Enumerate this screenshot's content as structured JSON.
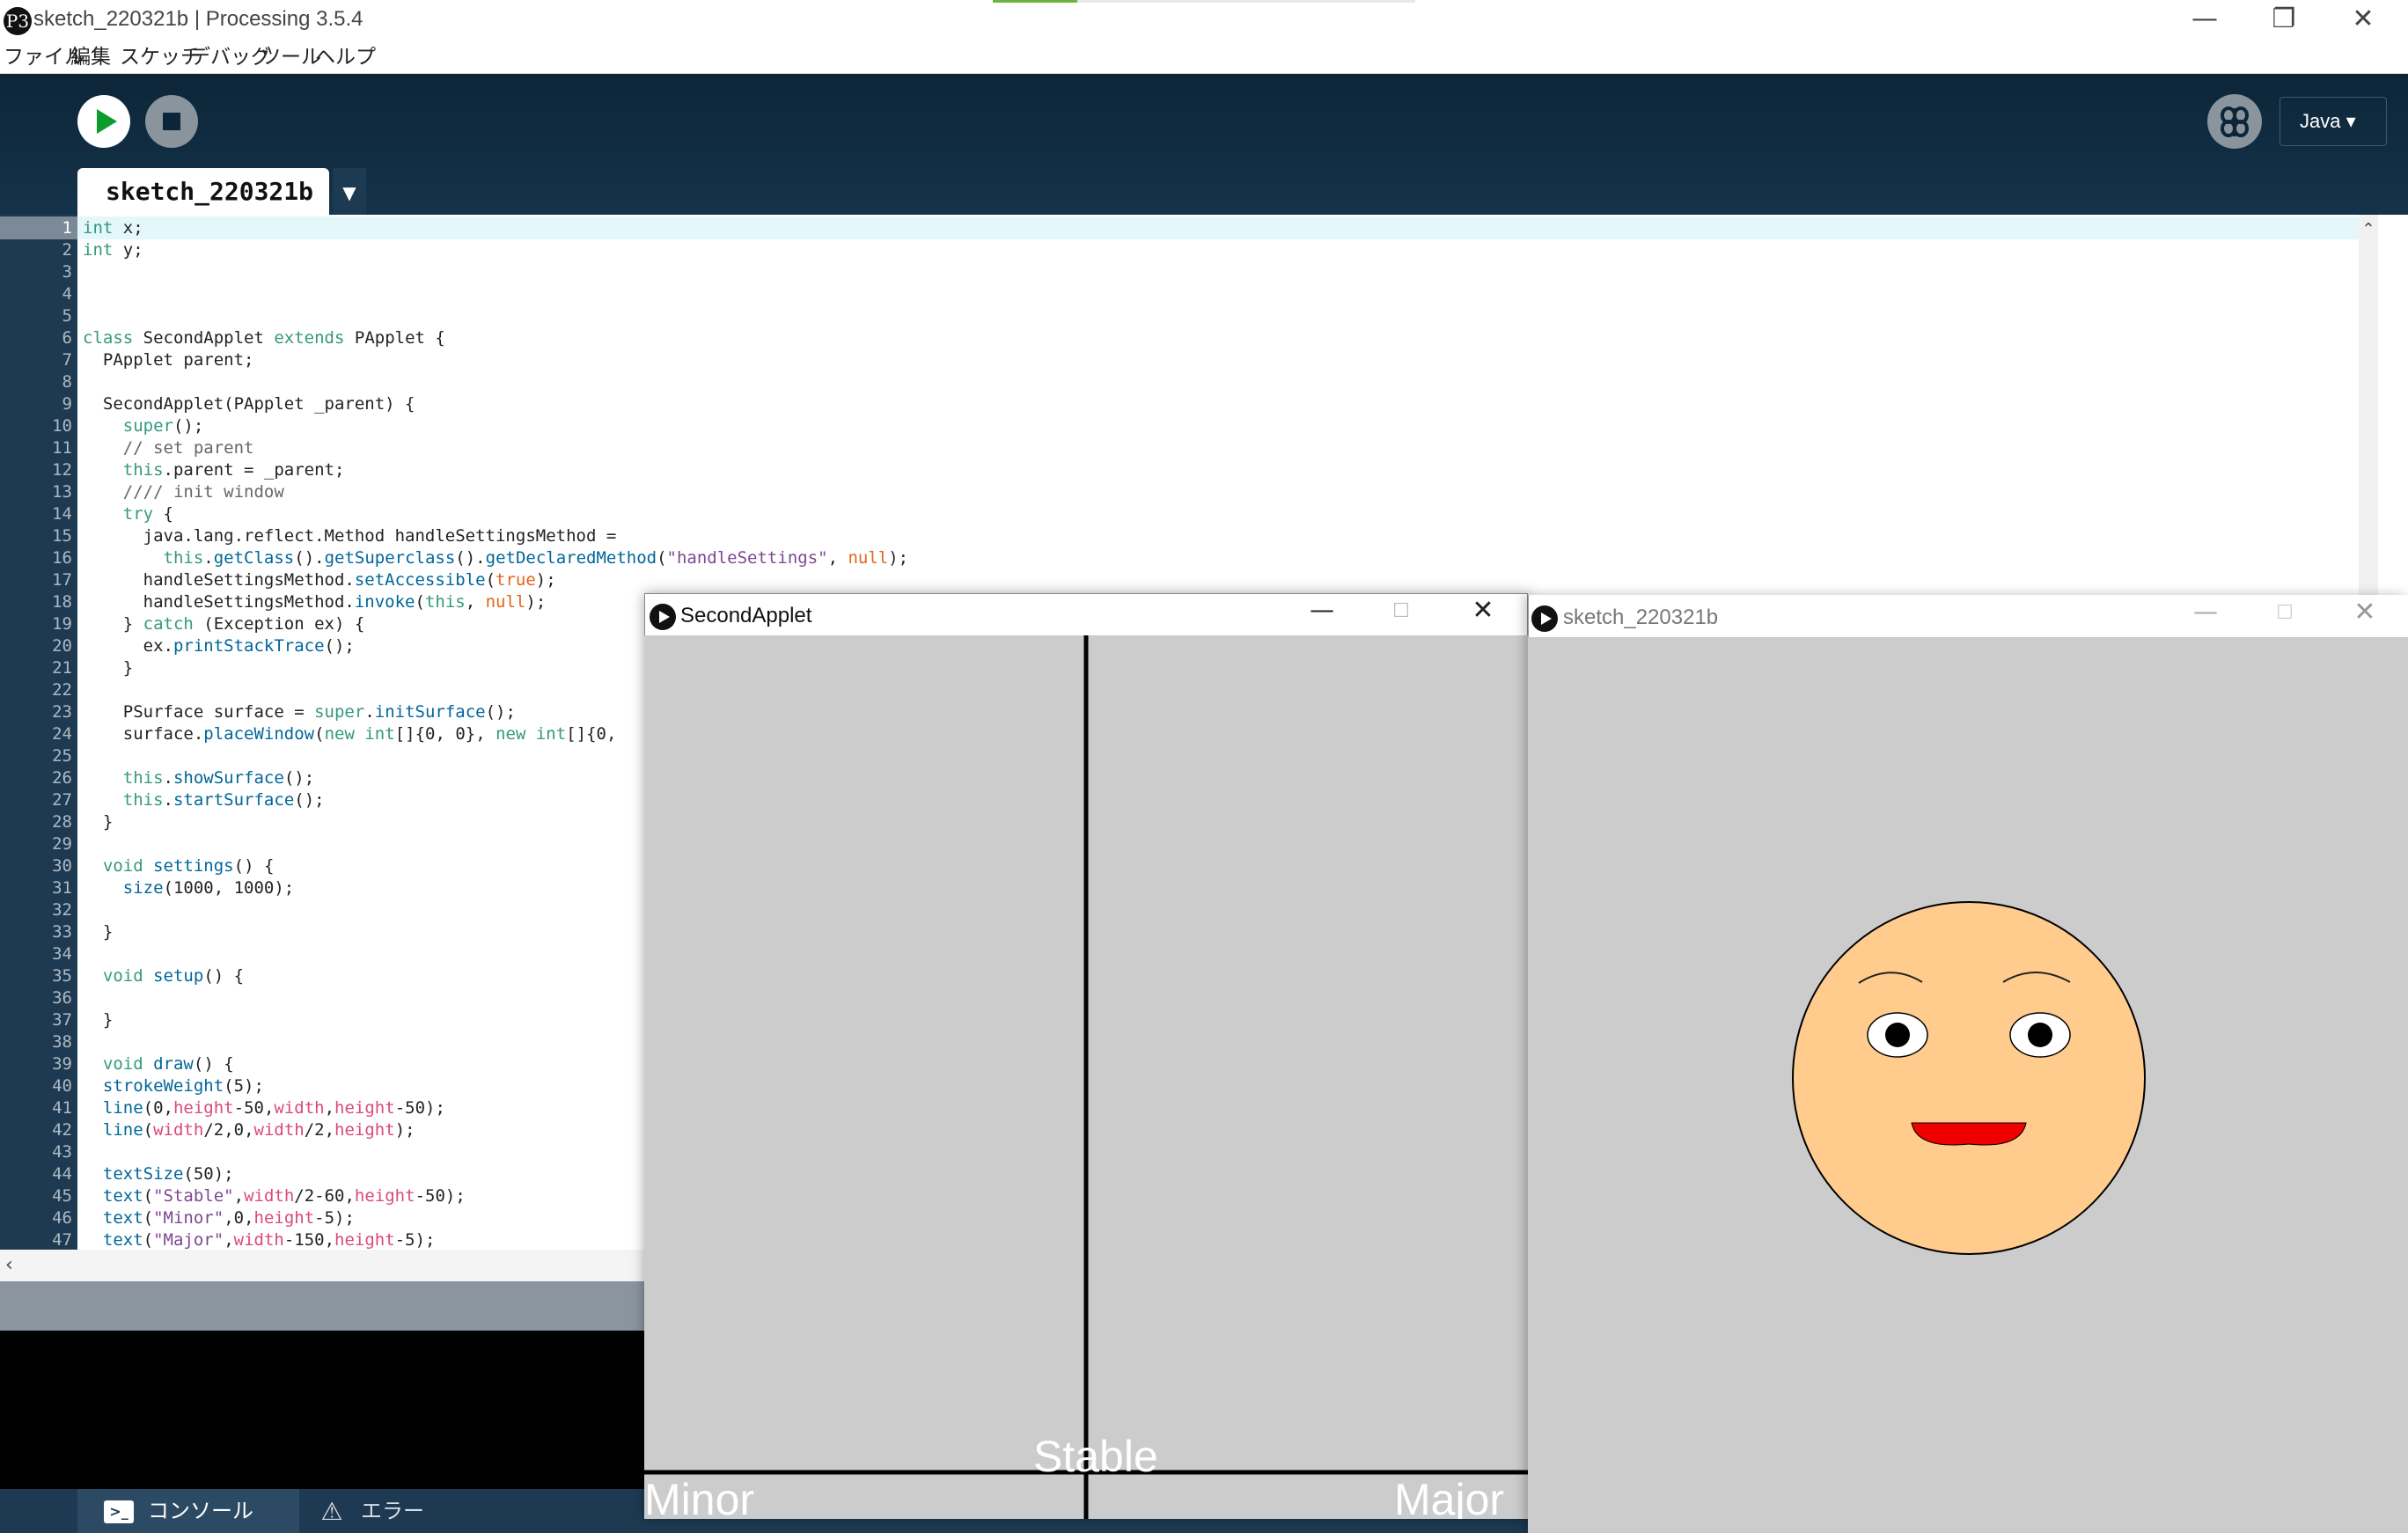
{
  "window": {
    "title": "sketch_220321b | Processing 3.5.4",
    "app_icon": "P3",
    "controls": {
      "minimize": "—",
      "restore": "❐",
      "close": "✕"
    },
    "progress_fraction": 0.2
  },
  "menu": [
    "ファイル",
    "編集",
    "スケッチ",
    "デバッグ",
    "ツール",
    "ヘルプ"
  ],
  "toolbar": {
    "run_icon": "play-icon",
    "stop_icon": "stop-icon",
    "debug_icon": "butterfly-icon",
    "mode": "Java ▾"
  },
  "tab": {
    "name": "sketch_220321b",
    "menu_arrow": "▼"
  },
  "editor": {
    "current_line": 1,
    "lines": [
      "int x;",
      "int y;",
      "",
      "",
      "",
      "class SecondApplet extends PApplet {",
      "  PApplet parent;",
      "",
      "  SecondApplet(PApplet _parent) {",
      "    super();",
      "    // set parent",
      "    this.parent = _parent;",
      "    //// init window",
      "    try {",
      "      java.lang.reflect.Method handleSettingsMethod =",
      "        this.getClass().getSuperclass().getDeclaredMethod(\"handleSettings\", null);",
      "      handleSettingsMethod.setAccessible(true);",
      "      handleSettingsMethod.invoke(this, null);",
      "    } catch (Exception ex) {",
      "      ex.printStackTrace();",
      "    }",
      "",
      "    PSurface surface = super.initSurface();",
      "    surface.placeWindow(new int[]{0, 0}, new int[]{0,",
      "",
      "    this.showSurface();",
      "    this.startSurface();",
      "  }",
      "",
      "  void settings() {",
      "    size(1000, 1000);",
      "",
      "  }",
      "",
      "  void setup() {",
      "",
      "  }",
      "",
      "  void draw() {",
      "  strokeWeight(5);",
      "  line(0,height-50,width,height-50);",
      "  line(width/2,0,width/2,height);",
      "",
      "  textSize(50);",
      "  text(\"Stable\",width/2-60,height-50);",
      "  text(\"Minor\",0,height-5);",
      "  text(\"Major\",width-150,height-5);"
    ]
  },
  "console_tabs": {
    "console": "コンソール",
    "console_icon": "console-icon",
    "error": "エラー",
    "error_icon": "warning-icon"
  },
  "second_applet": {
    "title": "SecondApplet",
    "labels": {
      "stable": "Stable",
      "minor": "Minor",
      "major": "Major"
    },
    "canvas_bg": "#cccccc"
  },
  "sketch_window": {
    "title": "sketch_220321b",
    "face_color": "#ffcc8e",
    "mouth_color": "#ee0000"
  }
}
